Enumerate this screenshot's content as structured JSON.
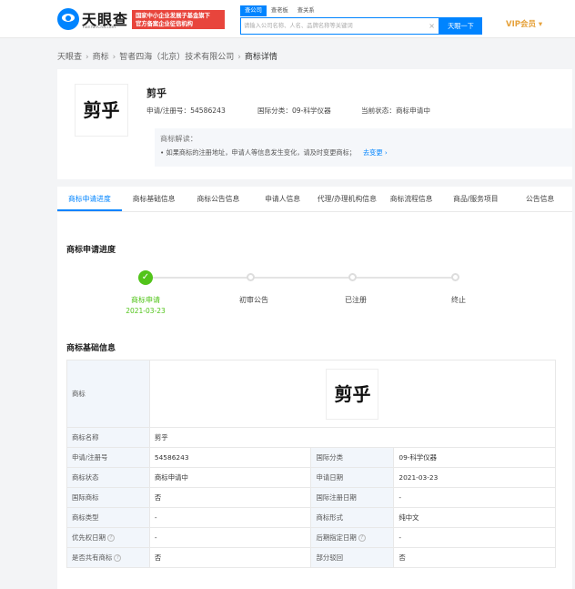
{
  "header": {
    "logo_text": "天眼查",
    "logo_sub": "TianYanCha.com",
    "badge_line1": "国家中小企业发展子基金旗下",
    "badge_line2": "官方备案企业征信机构",
    "search_tabs": [
      "查公司",
      "查老板",
      "查关系"
    ],
    "search_placeholder": "请输入公司名称、人名、品牌名称等关键词",
    "search_button": "天眼一下",
    "vip": "VIP会员 ▾"
  },
  "breadcrumb": [
    "天眼查",
    "商标",
    "智者四海（北京）技术有限公司",
    "商标详情"
  ],
  "trademark": {
    "image_text": "剪乎",
    "title": "剪乎",
    "reg_no": "申请/注册号：54586243",
    "class": "国际分类：09-科学仪器",
    "status": "当前状态：商标申请中",
    "explain_title": "商标解读：",
    "explain_text": "• 如果商标的注册地址，申请人等信息发生变化，请及时变更商标；",
    "explain_link": "去变更 ›"
  },
  "tabs": [
    "商标申请进度",
    "商标基础信息",
    "商标公告信息",
    "申请人信息",
    "代理/办理机构信息",
    "商标流程信息",
    "商品/服务项目",
    "公告信息"
  ],
  "progress": {
    "title": "商标申请进度",
    "steps": [
      {
        "label": "商标申请",
        "date": "2021-03-23"
      },
      {
        "label": "初审公告"
      },
      {
        "label": "已注册"
      },
      {
        "label": "终止"
      }
    ]
  },
  "basic": {
    "title": "商标基础信息",
    "image_label": "商标",
    "rows": [
      {
        "l1": "商标名称",
        "v1": "剪乎"
      },
      {
        "l1": "申请/注册号",
        "v1": "54586243",
        "l2": "国际分类",
        "v2": "09-科学仪器"
      },
      {
        "l1": "商标状态",
        "v1": "商标申请中",
        "l2": "申请日期",
        "v2": "2021-03-23"
      },
      {
        "l1": "国际商标",
        "v1": "否",
        "l2": "国际注册日期",
        "v2": "-"
      },
      {
        "l1": "商标类型",
        "v1": "-",
        "l2": "商标形式",
        "v2": "纯中文"
      },
      {
        "l1": "优先权日期",
        "v1": "-",
        "l2": "后期指定日期",
        "v2": "-"
      },
      {
        "l1": "是否共有商标",
        "v1": "否",
        "l2": "部分驳回",
        "v2": "否"
      }
    ]
  }
}
